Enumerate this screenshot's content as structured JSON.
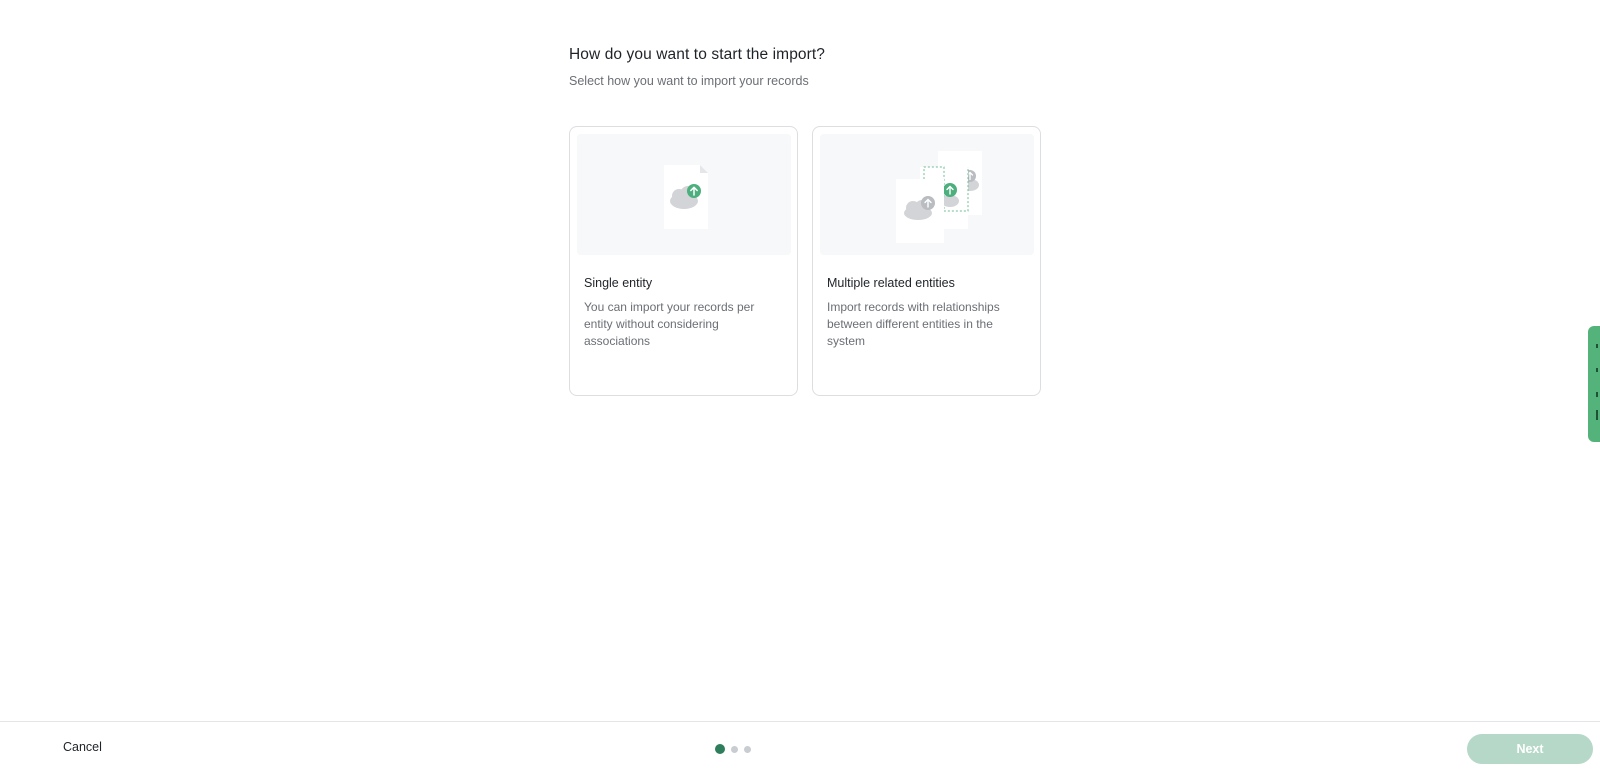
{
  "header": {
    "title": "How do you want to start the import?",
    "subtitle": "Select how you want to import your records"
  },
  "cards": [
    {
      "title": "Single entity",
      "description": "You can import your records per entity without considering associations",
      "icon": "single-file-upload-icon"
    },
    {
      "title": "Multiple related entities",
      "description": "Import records with relationships between different entities in the system",
      "icon": "multiple-files-upload-icon"
    }
  ],
  "footer": {
    "cancel_label": "Cancel",
    "next_label": "Next",
    "steps_total": 3,
    "current_step": 1
  },
  "colors": {
    "accent": "#2e7d5b",
    "upload_badge": "#4caf7d",
    "next_disabled": "#b5d8c8",
    "side_tab": "#54b27b"
  }
}
